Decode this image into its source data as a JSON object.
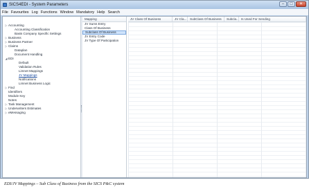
{
  "window": {
    "title": "SICS4EDI - System Parameters",
    "controls": {
      "minimize": "–",
      "maximize": "□",
      "close": "✕"
    }
  },
  "menu": [
    "File",
    "Favourites",
    "Log",
    "Functions",
    "Window",
    "Mandatory",
    "Help",
    "Search"
  ],
  "tree": {
    "items": [
      {
        "label": "Accounting",
        "expander": "▷",
        "level": 0
      },
      {
        "label": "Accounting Classification",
        "expander": "",
        "level": 1
      },
      {
        "label": "Basis Company Specific Settings",
        "expander": "",
        "level": 1
      },
      {
        "label": "Business",
        "expander": "▷",
        "level": 0
      },
      {
        "label": "Business Partner",
        "expander": "▷",
        "level": 0
      },
      {
        "label": "Claims",
        "expander": "▷",
        "level": 0
      },
      {
        "label": "Dataplan",
        "expander": "",
        "level": 1
      },
      {
        "label": "Document Handling",
        "expander": "",
        "level": 1
      },
      {
        "label": "EDI",
        "expander": "◢",
        "level": 0
      },
      {
        "label": "Default",
        "expander": "",
        "level": 2
      },
      {
        "label": "Validation Rules",
        "expander": "",
        "level": 2
      },
      {
        "label": "Limnet Mappings",
        "expander": "",
        "level": 2
      },
      {
        "label": "JV Mappings",
        "expander": "",
        "level": 2,
        "selected": true
      },
      {
        "label": "Notifications",
        "expander": "",
        "level": 2
      },
      {
        "label": "Limnet Business Logic",
        "expander": "",
        "level": 2
      },
      {
        "label": "Find",
        "expander": "▷",
        "level": 0
      },
      {
        "label": "Identifiers",
        "expander": "",
        "level": 0
      },
      {
        "label": "Module Key",
        "expander": "",
        "level": 0
      },
      {
        "label": "Notes",
        "expander": "",
        "level": 0
      },
      {
        "label": "Task Management",
        "expander": "▷",
        "level": 0
      },
      {
        "label": "Underwriters Estimates",
        "expander": "▷",
        "level": 0
      },
      {
        "label": "eMessaging",
        "expander": "▷",
        "level": 0
      }
    ]
  },
  "mapping_panel": {
    "header": "Mapping",
    "items": [
      {
        "label": "JV Sums Entry"
      },
      {
        "label": "Class Of Business"
      },
      {
        "label": "Subclass Of Business",
        "selected": true
      },
      {
        "label": "JV Entry Code"
      },
      {
        "label": "JV Type Of Participation"
      }
    ]
  },
  "grid": {
    "columns": [
      {
        "label": "JV Class Of Business"
      },
      {
        "label": "JV Cla..."
      },
      {
        "label": "SubClass Of Business"
      },
      {
        "label": "Subcla..."
      },
      {
        "label": "Is Used For Sending"
      }
    ]
  },
  "caption": "EDI/JV Mappings – Sub Class of Business from the SICS P&C system"
}
